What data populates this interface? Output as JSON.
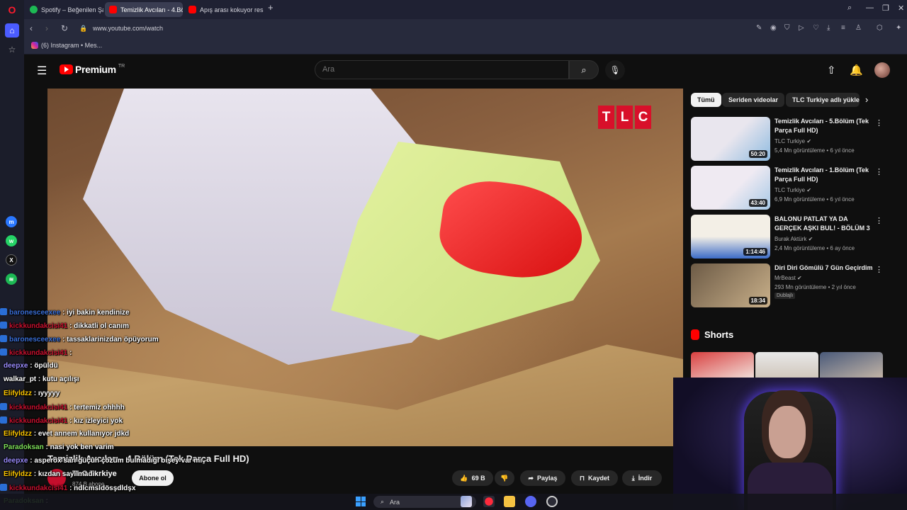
{
  "browser": {
    "tabs": [
      {
        "label": "Spotify – Beğenilen Şarkılar",
        "active": false,
        "color": "#1db954"
      },
      {
        "label": "Temizlik Avcıları - 4.Bö",
        "active": true,
        "color": "#ff0000"
      },
      {
        "label": "Apış arası kokuyor resmen",
        "active": false,
        "color": "#ff0000"
      }
    ],
    "new_tab": "+",
    "url": "www.youtube.com/watch",
    "bookmark": "(6) Instagram • Mes..."
  },
  "youtube": {
    "brand": "Premium",
    "region": "TR",
    "search_placeholder": "Ara",
    "chips": [
      "Tümü",
      "Seriden videolar",
      "TLC Turkiye adlı yükle"
    ],
    "video": {
      "logo_letters": [
        "T",
        "L",
        "C"
      ],
      "title": "Temizlik Avcıları - 4.Bölüm (Tek Parça Full HD)",
      "channel": "TLC Turkiye",
      "subscribers": "874 B abone",
      "subscribe_label": "Abone ol",
      "likes": "69 B",
      "share_label": "Paylaş",
      "save_label": "Kaydet",
      "download_label": "İndir"
    },
    "recommendations": [
      {
        "title": "Temizlik Avcıları - 5.Bölüm (Tek Parça Full HD)",
        "channel": "TLC Turkiye",
        "meta": "5,4 Mn görüntüleme • 6 yıl önce",
        "duration": "50:20",
        "thumb": [
          "#e9e6ee",
          "#8fbbe0"
        ]
      },
      {
        "title": "Temizlik Avcıları - 1.Bölüm (Tek Parça Full HD)",
        "channel": "TLC Turkiye",
        "meta": "6,9 Mn görüntüleme • 6 yıl önce",
        "duration": "43:40",
        "thumb": [
          "#efeaf2",
          "#a7c9e6"
        ]
      },
      {
        "title": "BALONU PATLAT YA DA GERÇEK AŞKI BUL! - BÖLÜM 3",
        "channel": "Burak Aktürk",
        "meta": "2,4 Mn görüntüleme • 6 ay önce",
        "duration": "1:14:46",
        "thumb": [
          "#f3efe6",
          "#3c6cc8"
        ]
      },
      {
        "title": "Diri Diri Gömülü 7 Gün Geçirdim",
        "channel": "MrBeast",
        "meta": "293 Mn görüntüleme • 2 yıl önce",
        "duration": "18:34",
        "badge": "Dublajlı",
        "thumb": [
          "#6d5b46",
          "#c9b08a"
        ]
      }
    ],
    "shorts_label": "Shorts"
  },
  "chat": [
    {
      "user": "baronesceexee",
      "msg": ": iyi bakin kendinize",
      "color": "#3a6fd8",
      "badge": true
    },
    {
      "user": "kickkundakcisi41",
      "msg": ": dikkatli ol canım",
      "color": "#c8102e",
      "badge": true
    },
    {
      "user": "baronesceexee",
      "msg": ": tassaklarinizdan öpüyorum",
      "color": "#3a6fd8",
      "badge": true
    },
    {
      "user": "kickkundakcisi41",
      "msg": ":",
      "color": "#c8102e",
      "badge": true
    },
    {
      "user": "deepxe",
      "msg": ": öpüldü",
      "color": "#9b8cff",
      "badge": false
    },
    {
      "user": "walkar_pt",
      "msg": ": kutu açılışı",
      "color": "#ffffff",
      "badge": false
    },
    {
      "user": "Elifyldzz",
      "msg": ": ıyyyyy",
      "color": "#ffc800",
      "badge": false
    },
    {
      "user": "kickkundakcisi41",
      "msg": ": tertemiz ohhhh",
      "color": "#c8102e",
      "badge": true
    },
    {
      "user": "kickkundakcisi41",
      "msg": ": kız izleyici yok",
      "color": "#c8102e",
      "badge": true
    },
    {
      "user": "Elifyldzz",
      "msg": ": evet annem kullanıyor jdkd",
      "color": "#ffc800",
      "badge": false
    },
    {
      "user": "Paradoksan",
      "msg": ": nasi yok ben varim",
      "color": "#7ee05a",
      "badge": false
    },
    {
      "user": "deepxe",
      "msg": ": asperox sarı güçün çözüm bulmadığı bişey var mı",
      "color": "#9b8cff",
      "badge": false
    },
    {
      "user": "Elifyldzz",
      "msg": ": kızdan sayılmadık",
      "color": "#ffc800",
      "badge": false
    },
    {
      "user": "kickkundakcisi41",
      "msg": ": ndlcmsldösşdldşx",
      "color": "#c8102e",
      "badge": true
    },
    {
      "user": "Paradoksan",
      "msg": ":",
      "color": "#7ee05a",
      "badge": false
    }
  ],
  "taskbar": {
    "search_placeholder": "Ara"
  }
}
